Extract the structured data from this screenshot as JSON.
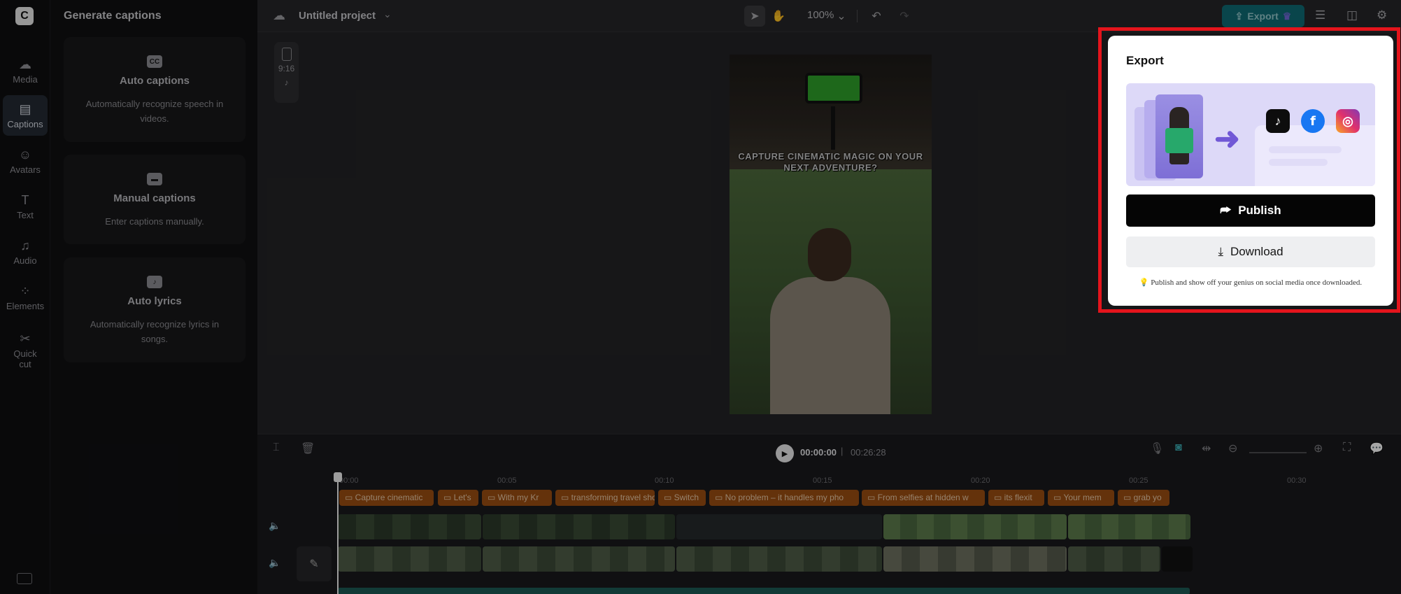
{
  "rail": {
    "logo": "C",
    "items": [
      {
        "label": "Media",
        "icon": "☁"
      },
      {
        "label": "Captions",
        "icon": "▤"
      },
      {
        "label": "Avatars",
        "icon": "☺"
      },
      {
        "label": "Text",
        "icon": "T"
      },
      {
        "label": "Audio",
        "icon": "♫"
      },
      {
        "label": "Elements",
        "icon": "⁘"
      },
      {
        "label": "Quick",
        "label2": "cut",
        "icon": "✂"
      }
    ]
  },
  "panel": {
    "title": "Generate captions",
    "cards": [
      {
        "title": "Auto captions",
        "icon": "CC",
        "desc": "Automatically recognize speech in videos."
      },
      {
        "title": "Manual captions",
        "icon": "▬",
        "desc": "Enter captions manually."
      },
      {
        "title": "Auto lyrics",
        "icon": "♪",
        "desc": "Automatically recognize lyrics in songs."
      }
    ]
  },
  "topbar": {
    "project_name": "Untitled project",
    "zoom": "100%",
    "export_label": "Export"
  },
  "canvas": {
    "ratio": "9:16",
    "caption_text": "CAPTURE CINEMATIC MAGIC ON YOUR NEXT ADVENTURE?"
  },
  "timeline": {
    "current_time": "00:00:00",
    "total_time": "00:26:28",
    "ticks": [
      "00:00",
      "00:05",
      "00:10",
      "00:15",
      "00:20",
      "00:25",
      "00:30"
    ],
    "captions": [
      "Capture cinematic",
      "Let's",
      "With my Kr",
      "transforming travel sho",
      "Switch",
      "No problem – it handles my pho",
      "From selfies at hidden w",
      "its flexit",
      "Your mem",
      "grab yo"
    ]
  },
  "export_popup": {
    "title": "Export",
    "publish_label": "Publish",
    "download_label": "Download",
    "tip": "💡 Publish and show off your genius on social media once downloaded."
  },
  "colors": {
    "export_accent": "#0f6b73",
    "caption_track": "#9a4d12",
    "highlight_outline": "#e4141c",
    "publish_bg": "#050505"
  }
}
